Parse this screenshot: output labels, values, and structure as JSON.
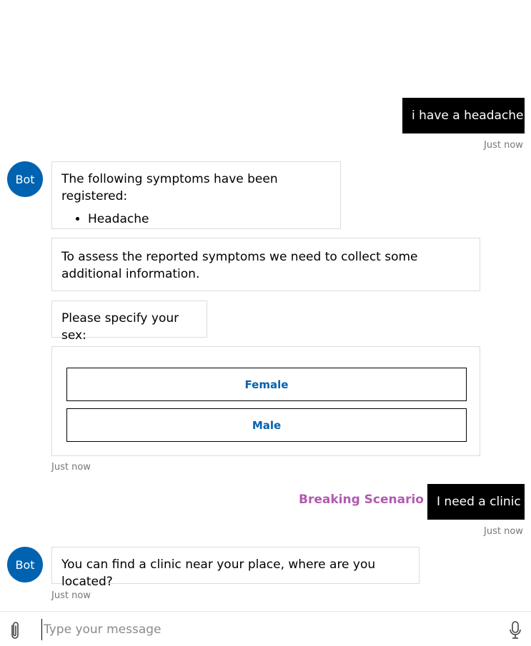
{
  "messages": {
    "user1": {
      "text": "i have a headache",
      "timestamp": "Just now"
    },
    "bot_avatar_label": "Bot",
    "bot1": {
      "intro": "The following symptoms have been registered:",
      "symptoms": [
        "Headache"
      ]
    },
    "bot2": {
      "text": "To assess the reported symptoms we need to collect some additional information."
    },
    "bot3": {
      "text": "Please specify your sex:"
    },
    "bot4": {
      "buttons": [
        "Female",
        "Male"
      ]
    },
    "bot_group1_timestamp": "Just now",
    "breaking_label": "Breaking Scenario",
    "user2": {
      "text": "I need a clinic",
      "timestamp": "Just now"
    },
    "bot5": {
      "text": "You can find a clinic near your place, where are you located?",
      "timestamp": "Just now"
    }
  },
  "input": {
    "placeholder": "Type your message"
  },
  "colors": {
    "accent": "#0063b1",
    "user_bubble": "#000000",
    "breaking_label": "#b05bb0"
  },
  "icons": {
    "attach": "paperclip-icon",
    "mic": "microphone-icon"
  }
}
